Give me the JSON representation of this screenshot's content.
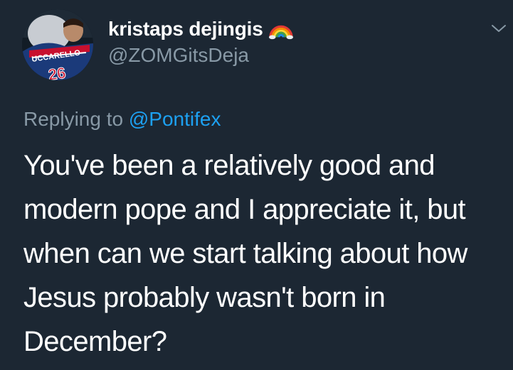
{
  "user": {
    "display_name": "kristaps dejingis",
    "name_emoji_icon": "rainbow-icon",
    "handle": "@ZOMGitsDeja",
    "avatar_jersey_text": "UCCARELLO",
    "avatar_jersey_number": "26"
  },
  "reply": {
    "prefix": "Replying to",
    "mention": "@Pontifex"
  },
  "tweet": {
    "lines": [
      "You've been a relatively good and",
      "modern pope and I appreciate it, but",
      "when can we start talking about how",
      "Jesus probably wasn't born in",
      "December?"
    ]
  },
  "menu_icon": "chevron-down-icon",
  "colors": {
    "background": "#1c2733",
    "primary_text": "#ffffff",
    "secondary_text": "#8899a6",
    "link": "#1da1f2"
  }
}
